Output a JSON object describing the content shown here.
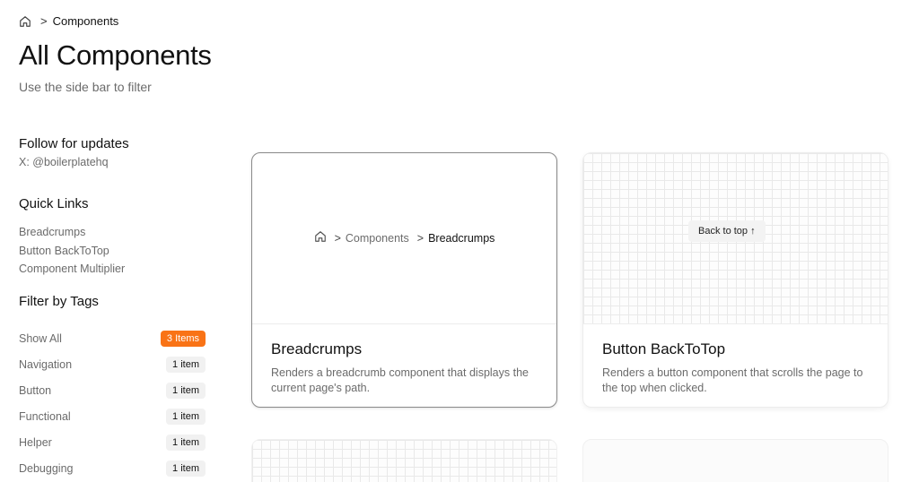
{
  "breadcrumb": {
    "current": "Components"
  },
  "page": {
    "title": "All Components",
    "subtitle": "Use the side bar to filter"
  },
  "sidebar": {
    "follow": {
      "heading": "Follow for updates",
      "handle": "X: @boilerplatehq"
    },
    "quick_links": {
      "heading": "Quick Links",
      "items": [
        "Breadcrumps",
        "Button BackToTop",
        "Component Multiplier"
      ]
    },
    "filter": {
      "heading": "Filter by Tags",
      "tags": [
        {
          "label": "Show All",
          "count": "3 Items",
          "active": true
        },
        {
          "label": "Navigation",
          "count": "1 item",
          "active": false
        },
        {
          "label": "Button",
          "count": "1 item",
          "active": false
        },
        {
          "label": "Functional",
          "count": "1 item",
          "active": false
        },
        {
          "label": "Helper",
          "count": "1 item",
          "active": false
        },
        {
          "label": "Debugging",
          "count": "1 item",
          "active": false
        }
      ]
    }
  },
  "cards": [
    {
      "title": "Breadcrumps",
      "description": "Renders a breadcrumb component that displays the current page's path.",
      "preview": {
        "crumb_mid": "Components",
        "crumb_current": "Breadcrumps"
      }
    },
    {
      "title": "Button BackToTop",
      "description": "Renders a button component that scrolls the page to the top when clicked.",
      "preview": {
        "button_label": "Back to top ↑"
      }
    }
  ],
  "colors": {
    "accent": "#f97316",
    "muted_text": "#6b6b6b",
    "badge_bg": "#f1f1f1"
  },
  "icons": {
    "home": "home-icon",
    "separator": "chevron-right-icon"
  }
}
